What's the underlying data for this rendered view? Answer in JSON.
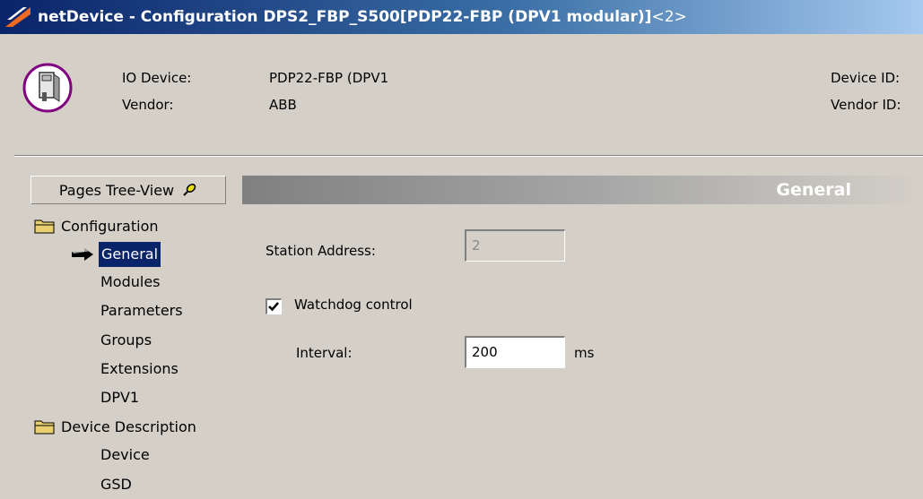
{
  "window": {
    "title_main": "netDevice - Configuration DPS2_FBP_S500[PDP22-FBP (DPV1 modular)]",
    "title_suffix": "<2>"
  },
  "device_info": {
    "io_device_label": "IO Device:",
    "io_device_value": "PDP22-FBP (DPV1",
    "vendor_label": "Vendor:",
    "vendor_value": "ABB",
    "device_id_label": "Device ID:",
    "vendor_id_label": "Vendor ID:"
  },
  "tree": {
    "header": "Pages Tree-View",
    "configuration": {
      "label": "Configuration",
      "items": [
        "General",
        "Modules",
        "Parameters",
        "Groups",
        "Extensions",
        "DPV1"
      ]
    },
    "device_description": {
      "label": "Device Description",
      "items": [
        "Device",
        "GSD"
      ]
    },
    "selected": "General"
  },
  "page": {
    "header": "General",
    "station_address_label": "Station Address:",
    "station_address_value": "2",
    "watchdog_label": "Watchdog control",
    "watchdog_checked": true,
    "interval_label": "Interval:",
    "interval_value": "200",
    "interval_unit": "ms"
  },
  "icons": {
    "title": "netdevice-icon",
    "device": "device-module-icon",
    "pin": "pin-icon",
    "folder": "folder-icon",
    "arrow": "arrow-right-icon",
    "check": "checkmark-icon"
  },
  "colors": {
    "titlebar_start": "#0a246a",
    "titlebar_end": "#a6caf0",
    "selection": "#0a246a",
    "face": "#d4d0c8"
  }
}
